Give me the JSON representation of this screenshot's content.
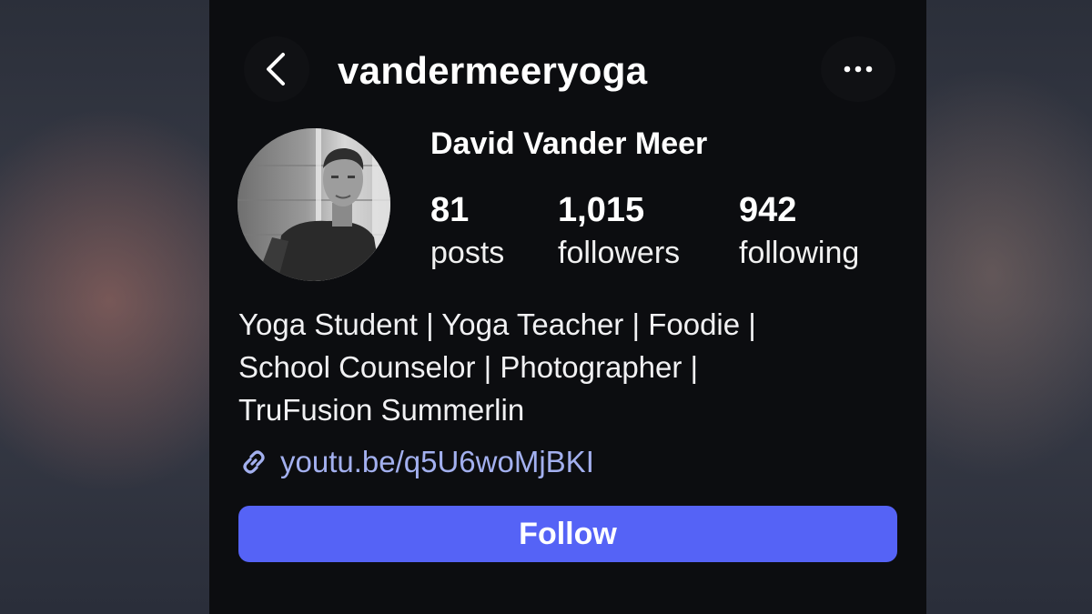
{
  "header": {
    "username": "vandermeeryoga",
    "back_icon": "chevron-left-icon",
    "more_icon": "more-horizontal-icon"
  },
  "profile": {
    "display_name": "David Vander Meer",
    "avatar": "profile-photo"
  },
  "stats": [
    {
      "value": "81",
      "label": "posts"
    },
    {
      "value": "1,015",
      "label": "followers"
    },
    {
      "value": "942",
      "label": "following"
    }
  ],
  "bio": {
    "lines": [
      "Yoga Student | Yoga Teacher | Foodie |",
      "School Counselor | Photographer |",
      "TruFusion Summerlin"
    ]
  },
  "link": {
    "icon": "link-icon",
    "text": "youtu.be/q5U6woMjBKI",
    "color": "#a3b0ef"
  },
  "actions": {
    "follow_label": "Follow",
    "follow_color": "#5563f6"
  }
}
